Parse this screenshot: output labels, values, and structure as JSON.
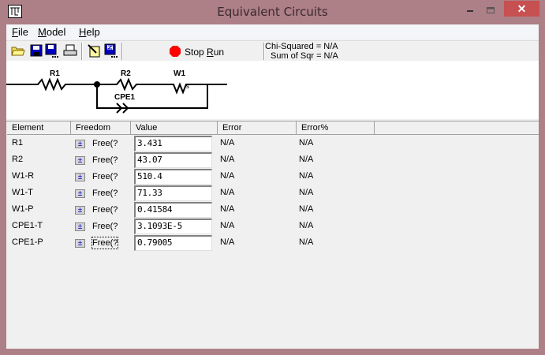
{
  "window": {
    "title": "Equivalent Circuits"
  },
  "menu": [
    {
      "label": "File",
      "u": "F",
      "rest": "ile"
    },
    {
      "label": "Model",
      "u": "M",
      "rest": "odel"
    },
    {
      "label": "Help",
      "u": "H",
      "rest": "elp"
    }
  ],
  "toolbar": {
    "stop_label_pre": "Stop ",
    "stop_label_u": "R",
    "stop_label_post": "un",
    "chi_squared": "Chi-Squared = N/A",
    "sum_of_sqr": "Sum of Sqr = N/A",
    "stop_color": "#ff0000"
  },
  "circuit": {
    "labels": {
      "r1": "R1",
      "r2": "R2",
      "w1": "W1",
      "w1_sub": "s",
      "cpe1": "CPE1"
    }
  },
  "table": {
    "headers": [
      "Element",
      "Freedom",
      "Value",
      "Error",
      "Error%"
    ],
    "rows": [
      {
        "element": "R1",
        "freedom": "Free(?",
        "value": "3.431",
        "error": "N/A",
        "error_pct": "N/A"
      },
      {
        "element": "R2",
        "freedom": "Free(?",
        "value": "43.07",
        "error": "N/A",
        "error_pct": "N/A"
      },
      {
        "element": "W1-R",
        "freedom": "Free(?",
        "value": "510.4",
        "error": "N/A",
        "error_pct": "N/A"
      },
      {
        "element": "W1-T",
        "freedom": "Free(?",
        "value": "71.33",
        "error": "N/A",
        "error_pct": "N/A"
      },
      {
        "element": "W1-P",
        "freedom": "Free(?",
        "value": "0.41584",
        "error": "N/A",
        "error_pct": "N/A"
      },
      {
        "element": "CPE1-T",
        "freedom": "Free(?",
        "value": "3.1093E-5",
        "error": "N/A",
        "error_pct": "N/A"
      },
      {
        "element": "CPE1-P",
        "freedom": "Free(?",
        "value": "0.79005",
        "error": "N/A",
        "error_pct": "N/A"
      }
    ]
  }
}
